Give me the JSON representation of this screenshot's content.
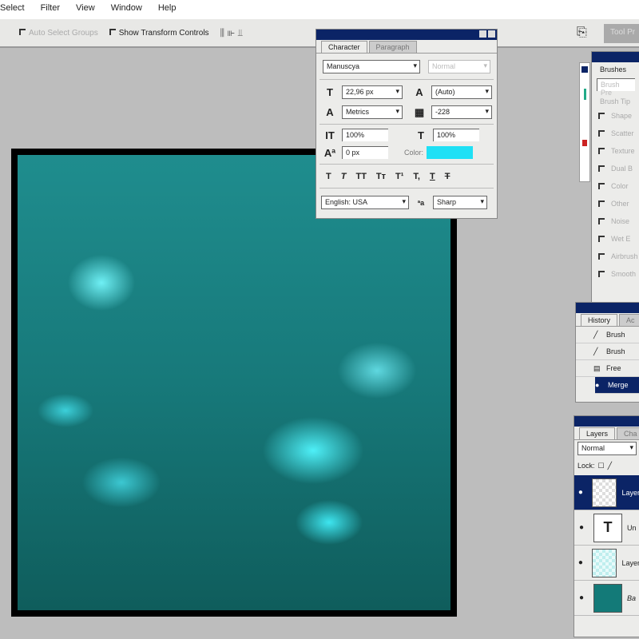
{
  "menu": [
    "Select",
    "Filter",
    "View",
    "Window",
    "Help"
  ],
  "options": {
    "auto_select": "Auto Select Groups",
    "show_transform": "Show Transform Controls",
    "right_btn": "Tool Pr"
  },
  "character": {
    "tabs": [
      "Character",
      "Paragraph"
    ],
    "font": "Manuscya",
    "style": "Normal",
    "size": "22,96 px",
    "leading": "(Auto)",
    "kerning": "Metrics",
    "tracking": "-228",
    "vscale": "100%",
    "hscale": "100%",
    "baseline": "0 px",
    "color_label": "Color:",
    "color": "#1fe0f5",
    "style_buttons": [
      "T",
      "T",
      "TT",
      "Tт",
      "T¹",
      "T,",
      "T",
      "T"
    ],
    "language": "English: USA",
    "aa_label": "ªa",
    "antialias": "Sharp"
  },
  "brushes": {
    "tab": "Brushes",
    "preset": "Brush Pre",
    "tip": "Brush Tip",
    "options": [
      "Shape",
      "Scatter",
      "Texture",
      "Dual B",
      "Color",
      "Other",
      "Noise",
      "Wet E",
      "Airbrush",
      "Smooth"
    ]
  },
  "history": {
    "tabs": [
      "History",
      "Ac"
    ],
    "items": [
      "Brush",
      "Brush",
      "Free",
      "Merge"
    ]
  },
  "layers": {
    "tabs": [
      "Layers",
      "Cha"
    ],
    "blend": "Normal",
    "lock": "Lock:",
    "items": [
      "Layer",
      "Un",
      "Layer",
      "Ba"
    ]
  }
}
